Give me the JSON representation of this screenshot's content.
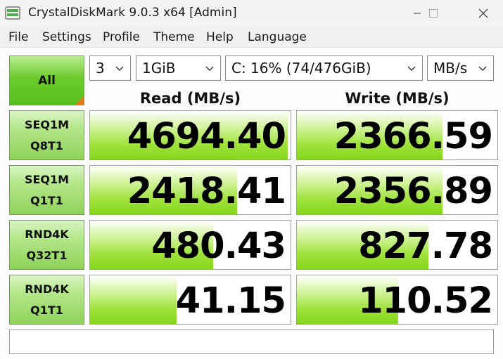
{
  "window": {
    "title": "CrystalDiskMark 9.0.3 x64 [Admin]",
    "icons": [
      "app-icon",
      "minimize-icon",
      "maximize-icon",
      "close-icon"
    ]
  },
  "menu": [
    "File",
    "Settings",
    "Profile",
    "Theme",
    "Help",
    "Language"
  ],
  "controls": {
    "all_label": "All",
    "count": "3",
    "size": "1GiB",
    "drive": "C: 16% (74/476GiB)",
    "unit": "MB/s"
  },
  "headers": {
    "read": "Read (MB/s)",
    "write": "Write (MB/s)"
  },
  "tests": [
    {
      "line1": "SEQ1M",
      "line2": "Q8T1",
      "read": "4694.40",
      "write": "2366.59",
      "read_fill": 0.987,
      "write_fill": 0.726
    },
    {
      "line1": "SEQ1M",
      "line2": "Q1T1",
      "read": "2418.41",
      "write": "2356.89",
      "read_fill": 0.735,
      "write_fill": 0.726
    },
    {
      "line1": "RND4K",
      "line2": "Q32T1",
      "read": "480.43",
      "write": "827.78",
      "read_fill": 0.613,
      "write_fill": 0.655
    },
    {
      "line1": "RND4K",
      "line2": "Q1T1",
      "read": "41.15",
      "write": "110.52",
      "read_fill": 0.432,
      "write_fill": 0.505
    }
  ],
  "comment": "",
  "colors": {
    "accent_green": "#86d61c",
    "corner_orange": "#e07a18"
  }
}
